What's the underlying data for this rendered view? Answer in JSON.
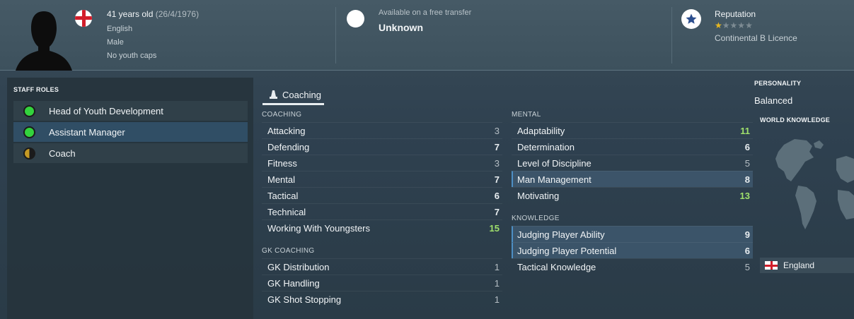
{
  "header": {
    "age": "41 years old",
    "dob": "(26/4/1976)",
    "nationality": "English",
    "gender": "Male",
    "youth_caps": "No youth caps",
    "transfer_label": "Available on a free transfer",
    "transfer_value": "Unknown",
    "reputation_label": "Reputation",
    "reputation_stars": 1,
    "reputation_max_stars": 5,
    "licence": "Continental B Licence",
    "flag_icon": "england-flag-icon",
    "reputation_icon": "star-icon"
  },
  "staff_roles": {
    "heading": "STAFF ROLES",
    "roles": [
      {
        "label": "Head of Youth Development",
        "suitability": "full"
      },
      {
        "label": "Assistant Manager",
        "suitability": "full",
        "selected": true
      },
      {
        "label": "Coach",
        "suitability": "half"
      }
    ]
  },
  "tab": {
    "label": "Coaching",
    "icon": "coaching-cone-icon"
  },
  "coaching": {
    "heading": "COACHING",
    "items": [
      {
        "name": "Attacking",
        "value": "3"
      },
      {
        "name": "Defending",
        "value": "7"
      },
      {
        "name": "Fitness",
        "value": "3"
      },
      {
        "name": "Mental",
        "value": "7"
      },
      {
        "name": "Tactical",
        "value": "6"
      },
      {
        "name": "Technical",
        "value": "7"
      },
      {
        "name": "Working With Youngsters",
        "value": "15"
      }
    ]
  },
  "gk_coaching": {
    "heading": "GK COACHING",
    "items": [
      {
        "name": "GK Distribution",
        "value": "1"
      },
      {
        "name": "GK Handling",
        "value": "1"
      },
      {
        "name": "GK Shot Stopping",
        "value": "1"
      }
    ]
  },
  "mental": {
    "heading": "MENTAL",
    "items": [
      {
        "name": "Adaptability",
        "value": "11"
      },
      {
        "name": "Determination",
        "value": "6"
      },
      {
        "name": "Level of Discipline",
        "value": "5"
      },
      {
        "name": "Man Management",
        "value": "8"
      },
      {
        "name": "Motivating",
        "value": "13"
      }
    ]
  },
  "knowledge": {
    "heading": "KNOWLEDGE",
    "items": [
      {
        "name": "Judging Player Ability",
        "value": "9"
      },
      {
        "name": "Judging Player Potential",
        "value": "6"
      },
      {
        "name": "Tactical Knowledge",
        "value": "5"
      }
    ]
  },
  "personality": {
    "heading": "PERSONALITY",
    "value": "Balanced"
  },
  "world_knowledge": {
    "heading": "WORLD KNOWLEDGE",
    "country": "England"
  },
  "colors": {
    "green": "#33d33d",
    "high_value": "#9fe06c",
    "star": "#e8b820",
    "flag_red": "#d21e2b"
  }
}
